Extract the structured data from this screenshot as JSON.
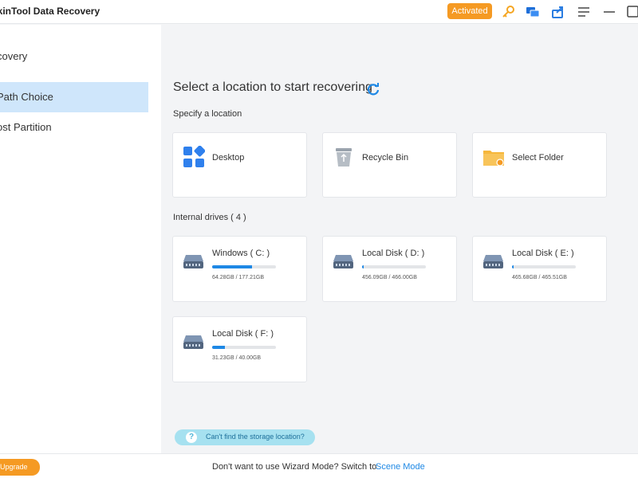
{
  "app": {
    "title": "rkinTool Data Recovery",
    "status_badge": "Activated"
  },
  "colors": {
    "accent": "#1e88e5",
    "orange": "#f59a23",
    "active_bg": "#cfe6fb"
  },
  "titlebar_icons": [
    "key-icon",
    "chat-icon",
    "share-icon",
    "menu-icon",
    "minimize-icon",
    "maximize-icon"
  ],
  "sidebar": {
    "items": [
      {
        "label": "covery"
      },
      {
        "label": "Path Choice",
        "active": true
      },
      {
        "label": "ost Partition"
      }
    ]
  },
  "main": {
    "title": "Select a location to start recovering",
    "specify_label": "Specify a location",
    "locations": [
      {
        "label": "Desktop",
        "icon": "desktop-icon"
      },
      {
        "label": "Recycle Bin",
        "icon": "recycle-bin-icon"
      },
      {
        "label": "Select Folder",
        "icon": "folder-icon"
      }
    ],
    "drives_label": "Internal drives ( 4 )",
    "drives": [
      {
        "label": "Windows ( C: )",
        "size": "64.28GB / 177.21GB",
        "used": 0.63
      },
      {
        "label": "Local Disk ( D: )",
        "size": "456.09GB / 466.00GB",
        "used": 0.02
      },
      {
        "label": "Local Disk ( E: )",
        "size": "465.68GB / 465.51GB",
        "used": 0.02
      },
      {
        "label": "Local Disk ( F: )",
        "size": "31.23GB / 40.00GB",
        "used": 0.2
      }
    ],
    "cant_find": "Can't find the storage location?"
  },
  "footer": {
    "upgrade": "Upgrade",
    "switch_text": "Don't want to use Wizard Mode? Switch to",
    "scene_mode": "Scene Mode"
  }
}
